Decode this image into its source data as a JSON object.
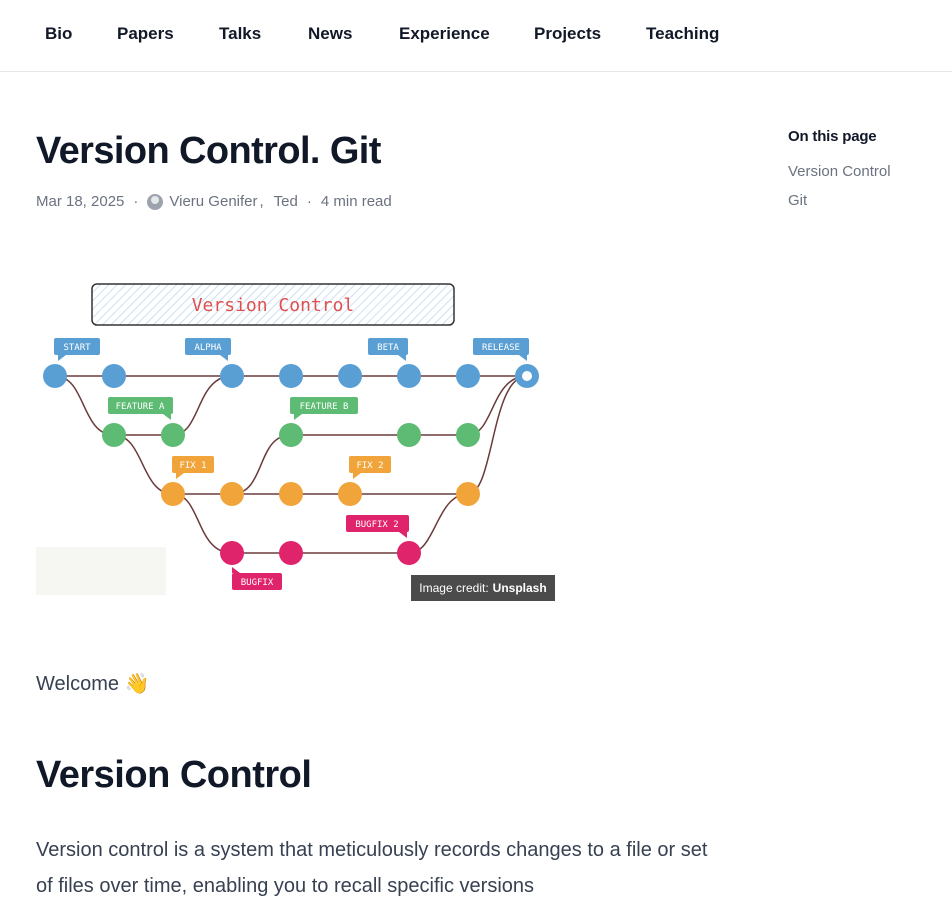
{
  "nav": {
    "items": [
      {
        "label": "Bio"
      },
      {
        "label": "Papers"
      },
      {
        "label": "Talks"
      },
      {
        "label": "News"
      },
      {
        "label": "Experience"
      },
      {
        "label": "Projects"
      },
      {
        "label": "Teaching"
      }
    ]
  },
  "article": {
    "title": "Version Control. Git",
    "date": "Mar 18, 2025",
    "authors": [
      "Vieru Genifer",
      "Ted"
    ],
    "author_separator": ",",
    "read_time": "4 min read",
    "image": {
      "banner": "Version Control",
      "tags": [
        "START",
        "ALPHA",
        "BETA",
        "RELEASE",
        "FEATURE A",
        "FEATURE B",
        "FIX 1",
        "FIX 2",
        "BUGFIX 2",
        "BUGFIX"
      ],
      "credit_prefix": "Image credit:",
      "credit_source": "Unsplash"
    },
    "welcome": "Welcome 👋",
    "section_title": "Version Control",
    "paragraph": "Version control is a system that meticulously records changes to a file or set of files over time, enabling you to recall specific versions"
  },
  "toc": {
    "title": "On this page",
    "links": [
      "Version Control",
      "Git"
    ]
  },
  "colors": {
    "main_branch": "#5a9fd4",
    "feature_branch": "#5dbb73",
    "fix_branch": "#f0a43a",
    "bugfix_branch": "#e0246c",
    "line": "#6b3b3b",
    "banner_text": "#e05050"
  }
}
